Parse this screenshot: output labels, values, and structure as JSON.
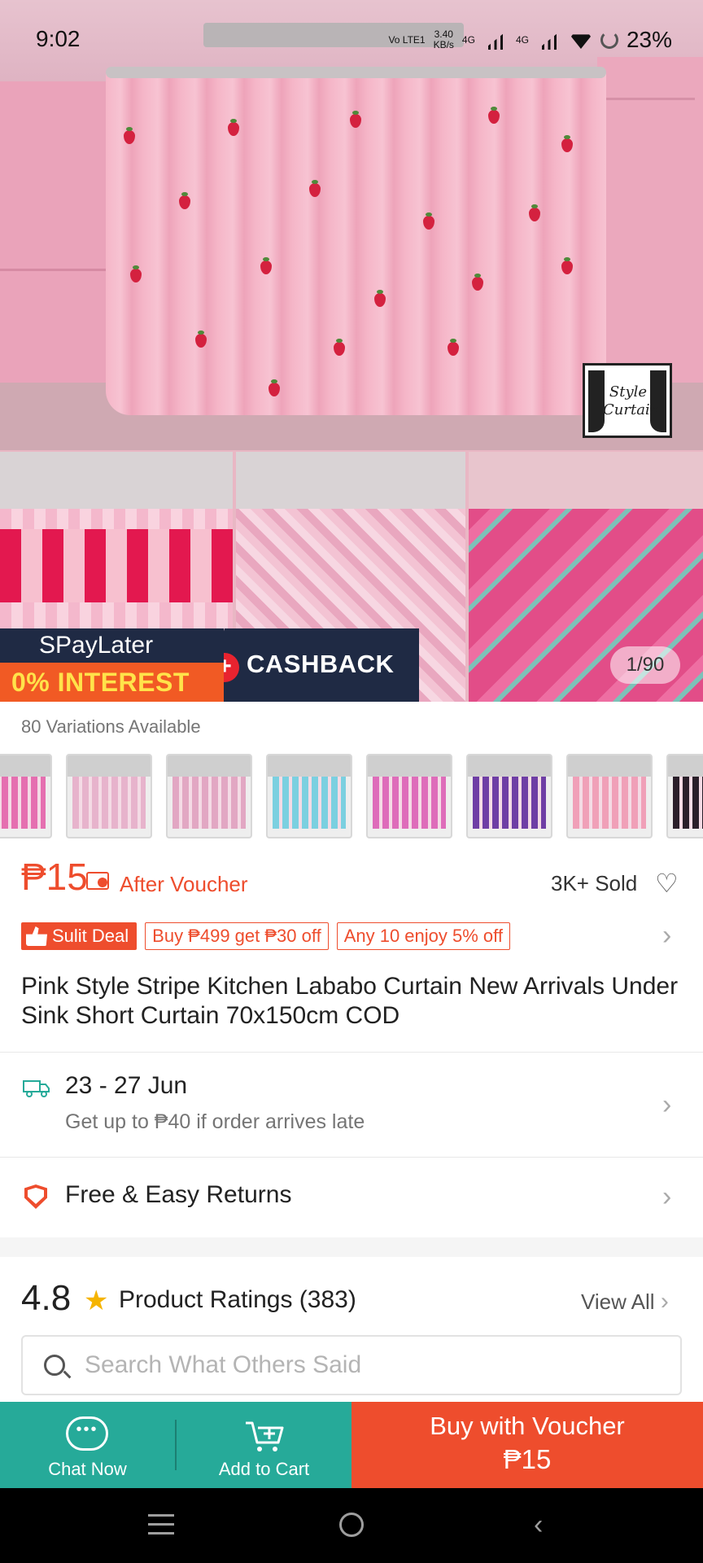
{
  "status_bar": {
    "time": "9:02",
    "network_speed": "3.40",
    "network_unit": "KB/s",
    "net_type_1": "4G",
    "net_type_2": "4G",
    "volte": "Vo LTE1",
    "battery": "23%"
  },
  "gallery": {
    "counter": "1/90",
    "logo_text": "Style Curtain",
    "promo_top": "SPayLater",
    "promo_bottom": "0% INTEREST",
    "promo_plus": "+",
    "promo_right": "CASHBACK"
  },
  "variations": {
    "label": "80 Variations Available",
    "swatch_colors": [
      "#e56fb0",
      "#e7b3cc",
      "#e2a7c3",
      "#7bd0e0",
      "#de6cba",
      "#6e3ea5",
      "#f0a0b8",
      "#2a1f2a"
    ]
  },
  "price": {
    "amount": "₱15",
    "after_voucher": "After Voucher",
    "sold": "3K+ Sold"
  },
  "deals": {
    "sulit": "Sulit Deal",
    "tag1": "Buy ₱499 get ₱30 off",
    "tag2": "Any 10 enjoy 5% off"
  },
  "product": {
    "title": "Pink Style Stripe Kitchen Lababo Curtain New Arrivals Under Sink Short Curtain 70x150cm COD"
  },
  "shipping": {
    "dates": "23 - 27 Jun",
    "note": "Get up to ₱40 if order arrives late"
  },
  "returns": {
    "label": "Free & Easy Returns"
  },
  "ratings": {
    "score": "4.8",
    "label": "Product Ratings (383)",
    "view_all": "View All",
    "search_placeholder": "Search What Others Said"
  },
  "bottom_bar": {
    "chat": "Chat Now",
    "cart": "Add to Cart",
    "buy_line1": "Buy with Voucher",
    "buy_line2": "₱15"
  },
  "colors": {
    "brand_orange": "#ee4d2d",
    "teal": "#26aa99"
  },
  "icons": [
    "heart-icon",
    "voucher-icon",
    "truck-icon",
    "shield-icon",
    "star-icon",
    "search-icon",
    "chat-icon",
    "cart-icon",
    "chevron-right-icon"
  ]
}
